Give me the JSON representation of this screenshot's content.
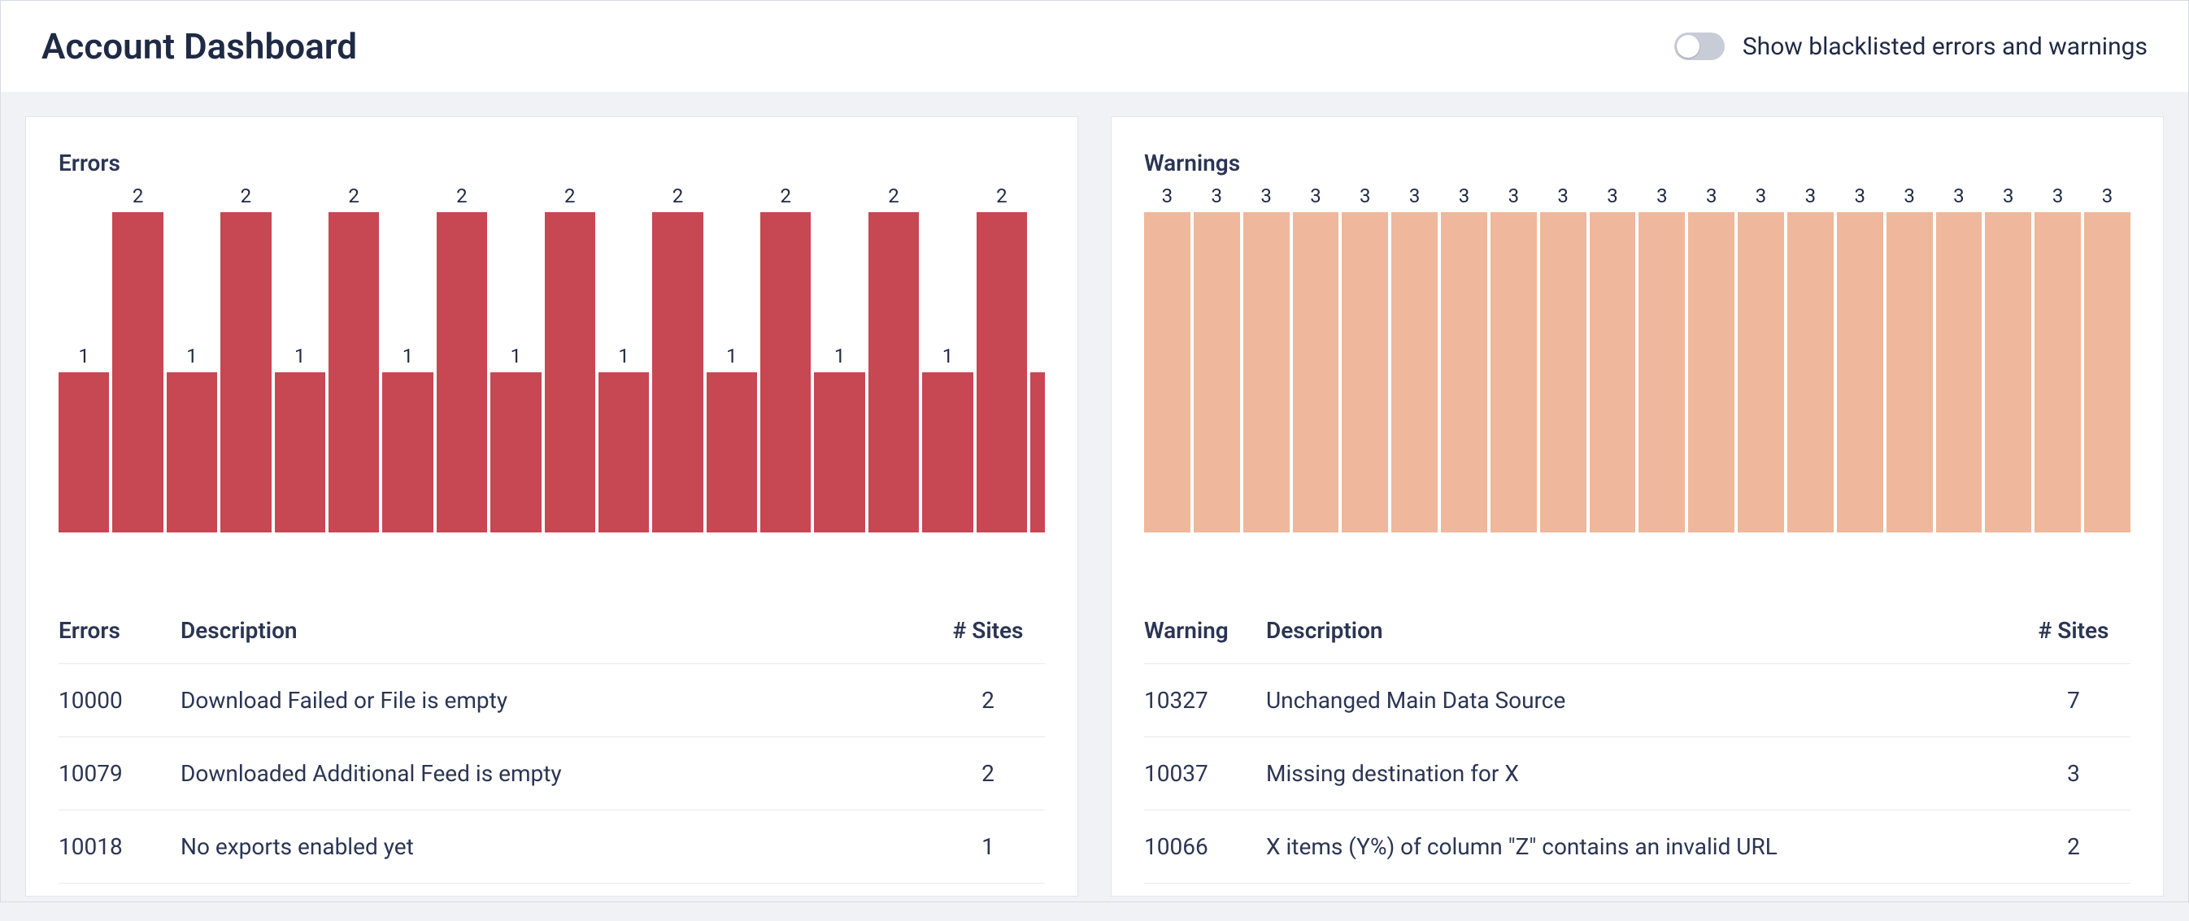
{
  "header": {
    "title": "Account Dashboard",
    "toggle_label": "Show blacklisted errors and warnings"
  },
  "panels": {
    "errors": {
      "title": "Errors",
      "color": "#c74753",
      "table_headers": {
        "code": "Errors",
        "desc": "Description",
        "sites": "# Sites"
      },
      "rows": [
        {
          "code": "10000",
          "desc": "Download Failed or File is empty",
          "sites": "2"
        },
        {
          "code": "10079",
          "desc": "Downloaded Additional Feed is empty",
          "sites": "2"
        },
        {
          "code": "10018",
          "desc": "No exports enabled yet",
          "sites": "1"
        }
      ]
    },
    "warnings": {
      "title": "Warnings",
      "color": "#efb79b",
      "table_headers": {
        "code": "Warning",
        "desc": "Description",
        "sites": "# Sites"
      },
      "rows": [
        {
          "code": "10327",
          "desc": "Unchanged Main Data Source",
          "sites": "7"
        },
        {
          "code": "10037",
          "desc": "Missing destination for X",
          "sites": "3"
        },
        {
          "code": "10066",
          "desc": "X items (Y%) of column \"Z\" contains an invalid URL",
          "sites": "2"
        }
      ]
    }
  },
  "chart_data": [
    {
      "type": "bar",
      "title": "Errors",
      "ylim": [
        0,
        2
      ],
      "values": [
        1,
        2,
        1,
        2,
        1,
        2,
        1,
        2,
        1,
        2,
        1,
        2,
        1,
        2,
        1,
        2,
        1,
        2,
        1
      ],
      "partial_last": true
    },
    {
      "type": "bar",
      "title": "Warnings",
      "ylim": [
        0,
        3
      ],
      "values": [
        3,
        3,
        3,
        3,
        3,
        3,
        3,
        3,
        3,
        3,
        3,
        3,
        3,
        3,
        3,
        3,
        3,
        3,
        3,
        3
      ]
    }
  ]
}
